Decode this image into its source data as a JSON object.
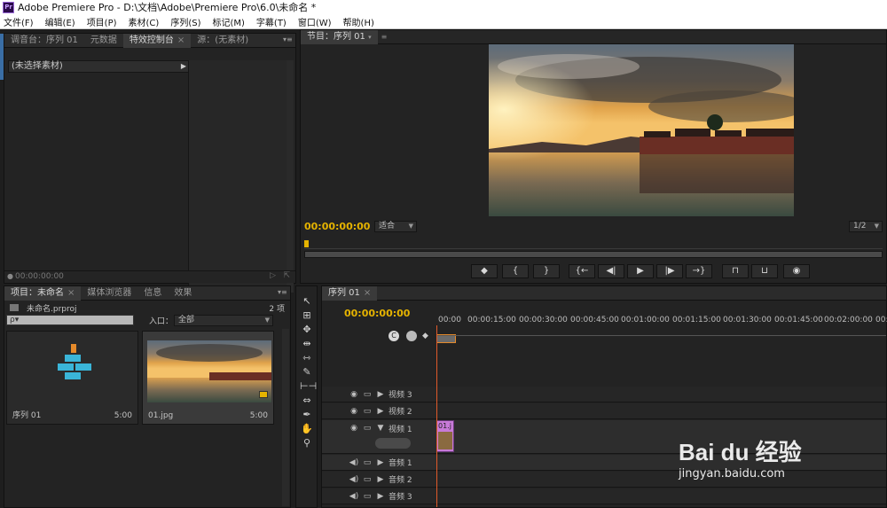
{
  "window": {
    "title": "Adobe Premiere Pro - D:\\文档\\Adobe\\Premiere Pro\\6.0\\未命名 *",
    "app_icon": "Pr"
  },
  "menu": [
    "文件(F)",
    "编辑(E)",
    "项目(P)",
    "素材(C)",
    "序列(S)",
    "标记(M)",
    "字幕(T)",
    "窗口(W)",
    "帮助(H)"
  ],
  "source_panel": {
    "tabs": [
      "调音台：序列 01",
      "元数据",
      "特效控制台",
      "源：(无素材)"
    ],
    "active_tab": "特效控制台",
    "clip_header": "(未选择素材)",
    "timecode": "00:00:00:00"
  },
  "program_panel": {
    "tab": "节目：序列 01",
    "timecode": "00:00:00:00",
    "fit": "适合",
    "resolution": "1/2",
    "image_name": "sunset-lake-pavilion-photo"
  },
  "project_panel": {
    "tabs": [
      "项目：未命名",
      "媒体浏览器",
      "信息",
      "效果"
    ],
    "item_count": "2 项",
    "project_file": "未命名.prproj",
    "search_placeholder": "ρ▾",
    "in_label": "入口：",
    "in_value": "全部",
    "items": [
      {
        "name": "序列 01",
        "duration": "5:00",
        "type": "sequence"
      },
      {
        "name": "01.jpg",
        "duration": "5:00",
        "type": "image"
      }
    ]
  },
  "timeline": {
    "tab": "序列 01",
    "timecode": "00:00:00:00",
    "ruler": [
      "00:00",
      "00:00:15:00",
      "00:00:30:00",
      "00:00:45:00",
      "00:01:00:00",
      "00:01:15:00",
      "00:01:30:00",
      "00:01:45:00",
      "00:02:00:00",
      "00:02:"
    ],
    "video_tracks": [
      "视频 3",
      "视频 2",
      "视频 1"
    ],
    "audio_tracks": [
      "音频 1",
      "音频 2",
      "音频 3"
    ],
    "clip_label": "01.j"
  },
  "watermark": {
    "brand": "Bai du 经验",
    "url": "jingyan.baidu.com"
  },
  "colors": {
    "timecode": "#e5b300",
    "clip": "#c77ad8",
    "playhead": "#e05a2a",
    "accent": "#3a6ea5"
  }
}
